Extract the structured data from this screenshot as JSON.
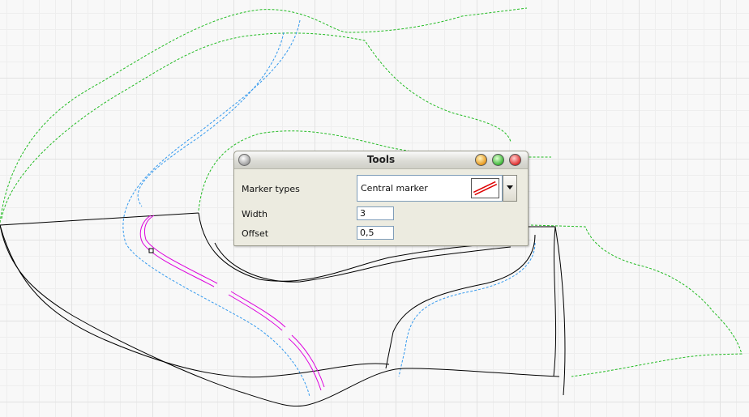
{
  "dialog": {
    "title": "Tools",
    "marker_types_label": "Marker types",
    "marker_type_value": "Central marker",
    "width_label": "Width",
    "width_value": "3",
    "offset_label": "Offset",
    "offset_value": "0,5"
  },
  "colors": {
    "outline": "#000000",
    "dashed_green": "#22bb22",
    "dashed_blue": "#3399ee",
    "marker_magenta": "#dd00dd"
  }
}
